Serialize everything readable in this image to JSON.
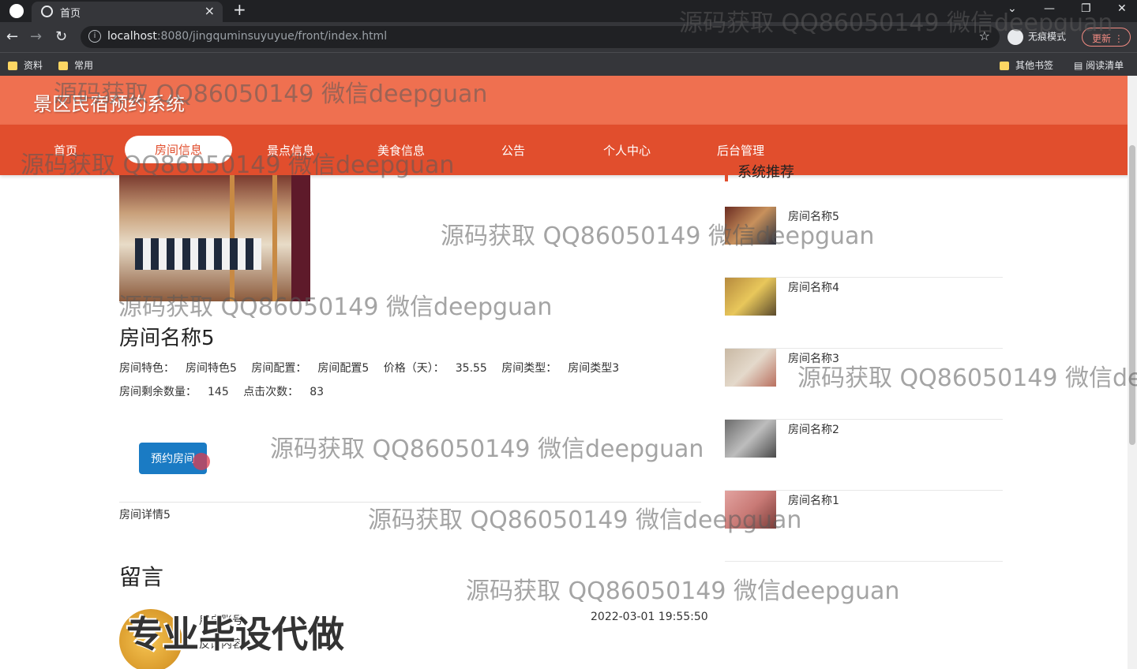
{
  "browser": {
    "tab_title": "首页",
    "tab_close": "×",
    "new_tab": "+",
    "url_host": "localhost",
    "url_rest": ":8080/jingquminsuyuyue/front/index.html",
    "incognito_label": "无痕模式",
    "update_label": "更新",
    "bookmarks": [
      "资料",
      "常用"
    ],
    "other_bookmarks": "其他书签",
    "reading_list": "阅读清单"
  },
  "site": {
    "title": "景区民宿预约系统",
    "nav": [
      "首页",
      "房间信息",
      "景点信息",
      "美食信息",
      "公告",
      "个人中心",
      "后台管理"
    ]
  },
  "room": {
    "name": "房间名称5",
    "feature_label": "房间特色：",
    "feature_value": "房间特色5",
    "config_label": "房间配置：",
    "config_value": "房间配置5",
    "price_label": "价格（天）：",
    "price_value": "35.55",
    "type_label": "房间类型：",
    "type_value": "房间类型3",
    "remaining_label": "房间剩余数量：",
    "remaining_value": "145",
    "clicks_label": "点击次数：",
    "clicks_value": "83",
    "book_button": "预约房间",
    "detail": "房间详情5"
  },
  "messages": {
    "title": "留言",
    "user": "用户账号",
    "content": "反馈内容",
    "time": "2022-03-01 19:55:50"
  },
  "recommend": {
    "title": "系统推荐",
    "items": [
      "房间名称5",
      "房间名称4",
      "房间名称3",
      "房间名称2",
      "房间名称1"
    ]
  },
  "watermarks": {
    "text": "源码获取 QQ86050149 微信deepguan",
    "big": "专业毕设代做"
  },
  "colors": {
    "header": "#ef7050",
    "nav": "#e14e2d",
    "button": "#1a7bc4"
  }
}
